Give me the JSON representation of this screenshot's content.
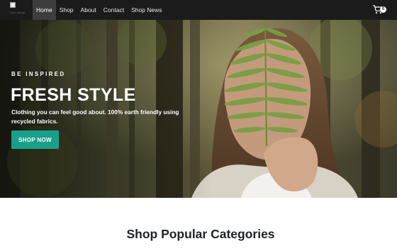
{
  "nav": {
    "logo_alt": "logo image",
    "links": [
      {
        "label": "Home",
        "active": true
      },
      {
        "label": "Shop",
        "active": false
      },
      {
        "label": "About",
        "active": false
      },
      {
        "label": "Contact",
        "active": false
      },
      {
        "label": "Shop News",
        "active": false
      }
    ],
    "cart_icon": "cart-icon",
    "cart_count": "0"
  },
  "hero": {
    "eyebrow": "BE INSPIRED",
    "title": "FRESH STYLE",
    "subtitle": "Clothing you can feel good about. 100% earth friendly using recycled fabrics.",
    "cta_label": "SHOP NOW",
    "cta_color": "#1aa08a",
    "image_subject": "woman-holding-fern"
  },
  "categories": {
    "heading": "Shop Popular Categories"
  },
  "colors": {
    "navbar_bg": "#1b1b1b",
    "nav_active_bg": "#3d3d3d",
    "accent": "#1aa08a",
    "heading_text": "#1f2226"
  }
}
